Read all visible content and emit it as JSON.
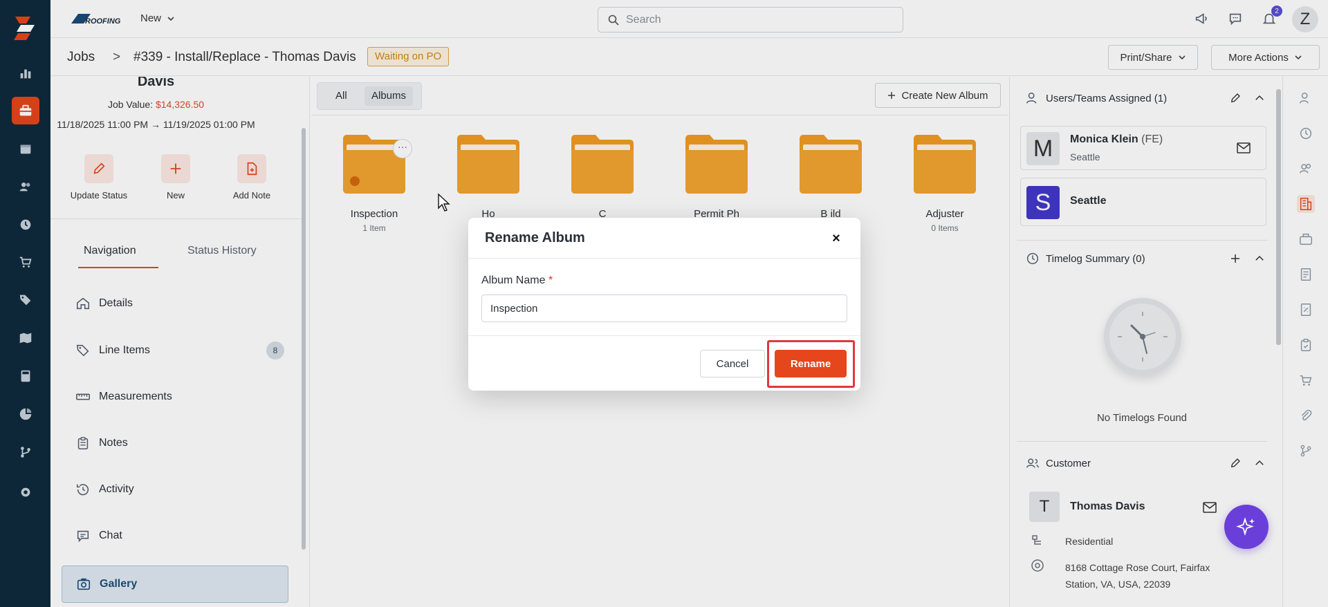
{
  "topbar": {
    "new_label": "New",
    "search_placeholder": "Search",
    "notification_count": "2",
    "avatar_initial": "Z"
  },
  "header": {
    "breadcrumb_root": "Jobs",
    "breadcrumb_sep": ">",
    "job_title": "#339 - Install/Replace - Thomas Davis",
    "status": "Waiting on PO",
    "print_share": "Print/Share",
    "more_actions": "More Actions"
  },
  "left": {
    "name": "Davis",
    "job_value_label": "Job Value:",
    "job_value": "$14,326.50",
    "dates": "11/18/2025 11:00 PM → 11/19/2025 01:00 PM",
    "quick_actions": [
      "Update Status",
      "New",
      "Add Note"
    ],
    "tabs": {
      "navigation": "Navigation",
      "status_history": "Status History"
    },
    "nav": [
      {
        "label": "Details"
      },
      {
        "label": "Line Items",
        "count": "8"
      },
      {
        "label": "Measurements"
      },
      {
        "label": "Notes"
      },
      {
        "label": "Activity"
      },
      {
        "label": "Chat"
      },
      {
        "label": "Gallery"
      }
    ]
  },
  "gallery": {
    "seg_all": "All",
    "seg_albums": "Albums",
    "create_album": "Create New Album",
    "albums": [
      {
        "name": "Inspection",
        "count": "1 Item"
      },
      {
        "name": "Ho",
        "count": ""
      },
      {
        "name": "C",
        "count": ""
      },
      {
        "name": "Permit  Ph",
        "count": ""
      },
      {
        "name": "B  ild",
        "count": ""
      },
      {
        "name": "Adjuster",
        "count": "0 Items"
      }
    ]
  },
  "right": {
    "users_title": "Users/Teams Assigned (1)",
    "user_initial": "M",
    "user_name": "Monica Klein",
    "user_role": "(FE)",
    "user_location": "Seattle",
    "team_initial": "S",
    "team_name": "Seattle",
    "timelog_title": "Timelog Summary (0)",
    "no_timelogs": "No Timelogs Found",
    "customer_title": "Customer",
    "customer_initial": "T",
    "customer_name": "Thomas Davis",
    "customer_type": "Residential",
    "customer_address_1": "8168 Cottage Rose Court, Fairfax",
    "customer_address_2": "Station, VA, USA, 22039"
  },
  "modal": {
    "title": "Rename Album",
    "close": "×",
    "field_label": "Album Name",
    "required_mark": "*",
    "field_value": "Inspection",
    "cancel": "Cancel",
    "rename": "Rename"
  },
  "colors": {
    "rail_bg": "#0f2a3d",
    "accent": "#e5461b",
    "folder": "#f29b24",
    "team_avatar": "#4338ca",
    "highlight": "#e0373d"
  }
}
